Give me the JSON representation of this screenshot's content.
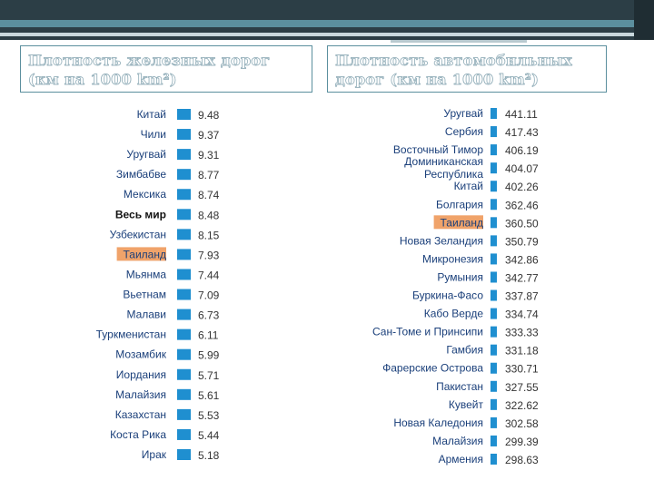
{
  "slide": {
    "title_left": "Плотность железных дорог (км на 1000 km²)",
    "title_right": "Плотность автомобильных дорог (км на 1000 km²)"
  },
  "colors": {
    "bar": "#1f8fd0",
    "highlight": "#f0a36a",
    "header_bar": "#2c3e46",
    "accent": "#5b8f9e"
  },
  "chart_data": [
    {
      "type": "bar",
      "orientation": "horizontal",
      "title": "Плотность железных дорог (км на 1000 km²)",
      "categories": [
        "Китай",
        "Чили",
        "Уругвай",
        "Зимбабве",
        "Мексика",
        "Весь мир",
        "Узбекистан",
        "Таиланд",
        "Мьянма",
        "Вьетнам",
        "Малави",
        "Туркменистан",
        "Мозамбик",
        "Иордания",
        "Малайзия",
        "Казахстан",
        "Коста Рика",
        "Ирак"
      ],
      "values": [
        9.48,
        9.37,
        9.31,
        8.77,
        8.74,
        8.48,
        8.15,
        7.93,
        7.44,
        7.09,
        6.73,
        6.11,
        5.99,
        5.71,
        5.61,
        5.53,
        5.44,
        5.18
      ],
      "value_labels": [
        "9.48",
        "9.37",
        "9.31",
        "8.77",
        "8.74",
        "8.48",
        "8.15",
        "7.93",
        "7.44",
        "7.09",
        "6.73",
        "6.11",
        "5.99",
        "5.71",
        "5.61",
        "5.53",
        "5.44",
        "5.18"
      ],
      "highlight": "Таиланд",
      "bold": "Весь мир"
    },
    {
      "type": "bar",
      "orientation": "horizontal",
      "title": "Плотность автомобильных дорог (км на 1000 km²)",
      "categories": [
        "Уругвай",
        "Сербия",
        "Восточный Тимор",
        "Доминиканская Республика",
        "Китай",
        "Болгария",
        "Таиланд",
        "Новая Зеландия",
        "Микронезия",
        "Румыния",
        "Буркина-Фасо",
        "Кабо Верде",
        "Сан-Томе и Принсипи",
        "Гамбия",
        "Фарерские Острова",
        "Пакистан",
        "Кувейт",
        "Новая Каледония",
        "Малайзия",
        "Армения"
      ],
      "values": [
        441.11,
        417.43,
        406.19,
        404.07,
        402.26,
        362.46,
        360.5,
        350.79,
        342.86,
        342.77,
        337.87,
        334.74,
        333.33,
        331.18,
        330.71,
        327.55,
        322.62,
        302.58,
        299.39,
        298.63
      ],
      "value_labels": [
        "441.11",
        "417.43",
        "406.19",
        "404.07",
        "402.26",
        "362.46",
        "360.50",
        "350.79",
        "342.86",
        "342.77",
        "337.87",
        "334.74",
        "333.33",
        "331.18",
        "330.71",
        "327.55",
        "322.62",
        "302.58",
        "299.39",
        "298.63"
      ],
      "highlight": "Таиланд"
    }
  ]
}
